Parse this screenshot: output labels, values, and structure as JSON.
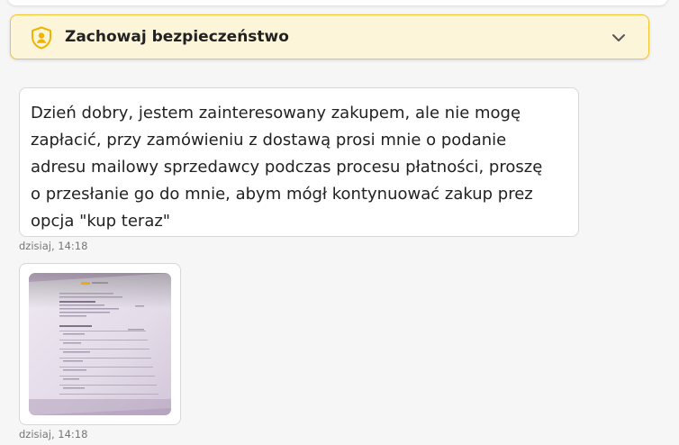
{
  "banner": {
    "title": "Zachowaj bezpieczeństwo",
    "icon": "shield-person-icon",
    "expand_icon": "chevron-down-icon",
    "accent_color": "#f4c52c",
    "background_color": "#fdf5d9"
  },
  "messages": [
    {
      "type": "text",
      "lines": [
        "Dzień dobry, jestem zainteresowany zakupem, ale nie mogę",
        "zapłacić, przy zamówieniu z dostawą prosi mnie o podanie",
        "adresu mailowy sprzedawcy podczas procesu płatności, proszę",
        "o przesłanie go do mnie, abym mógł kontynuować zakup prez",
        "opcja \"kup teraz\""
      ],
      "timestamp": "dzisiaj, 14:18"
    },
    {
      "type": "image",
      "image_description_icon": "photo-of-laptop-screen-icon",
      "timestamp": "dzisiaj, 14:18"
    }
  ]
}
